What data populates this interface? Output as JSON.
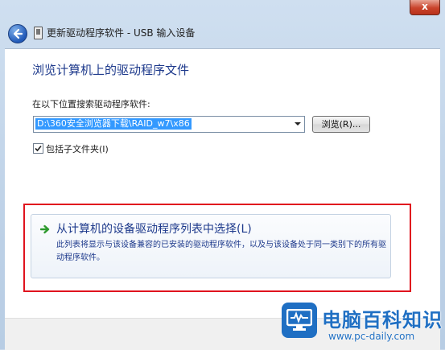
{
  "window": {
    "title": "更新驱动程序软件 - USB 输入设备",
    "close_label": "x"
  },
  "main": {
    "heading": "浏览计算机上的驱动程序文件",
    "location_label": "在以下位置搜索驱动程序软件:",
    "path_value": "D:\\360安全浏览器下载\\RAID_w7\\x86",
    "browse_label": "浏览(R)...",
    "include_subfolders_label": "包括子文件夹(I)",
    "include_subfolders_checked": true
  },
  "choice": {
    "title": "从计算机的设备驱动程序列表中选择(L)",
    "description": "此列表将显示与该设备兼容的已安装的驱动程序软件，以及与该设备处于同一类别下的所有驱动程序软件。"
  },
  "watermark": {
    "name": "电脑百科知识",
    "url": "www.pc-daily.com"
  }
}
